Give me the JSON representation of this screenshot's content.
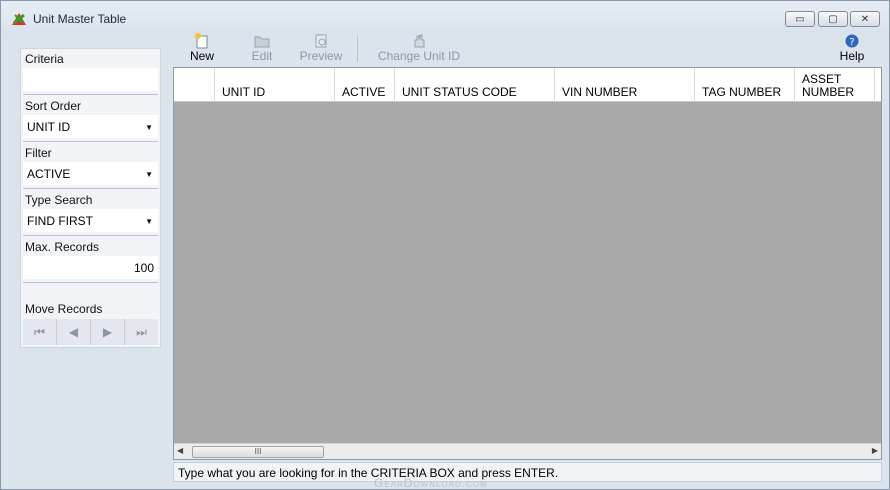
{
  "window": {
    "title": "Unit Master Table",
    "controls": {
      "minimize": "▭",
      "maximize": "▢",
      "close": "✕"
    }
  },
  "sidebar": {
    "criteria_label": "Criteria",
    "criteria_value": "",
    "sort_order_label": "Sort Order",
    "sort_order_value": "UNIT ID",
    "filter_label": "Filter",
    "filter_value": "ACTIVE",
    "type_search_label": "Type Search",
    "type_search_value": "FIND FIRST",
    "max_records_label": "Max. Records",
    "max_records_value": "100",
    "move_records_label": "Move Records",
    "nav": {
      "first": "⏮",
      "prev": "◀",
      "next": "▶",
      "last": "⏭"
    }
  },
  "toolbar": {
    "new_label": "New",
    "edit_label": "Edit",
    "preview_label": "Preview",
    "change_label": "Change Unit ID",
    "help_label": "Help"
  },
  "grid": {
    "columns": [
      "UNIT ID",
      "ACTIVE",
      "UNIT STATUS CODE",
      "VIN NUMBER",
      "TAG NUMBER",
      "ASSET NUMBER"
    ],
    "scroll_thumb": "III"
  },
  "status_text": "Type what you are looking for in the CRITERIA BOX and press ENTER.",
  "watermark": "GearDownload.com",
  "colors": {
    "accent": "#1f5fb3",
    "grid_bg": "#a9a9a9"
  }
}
